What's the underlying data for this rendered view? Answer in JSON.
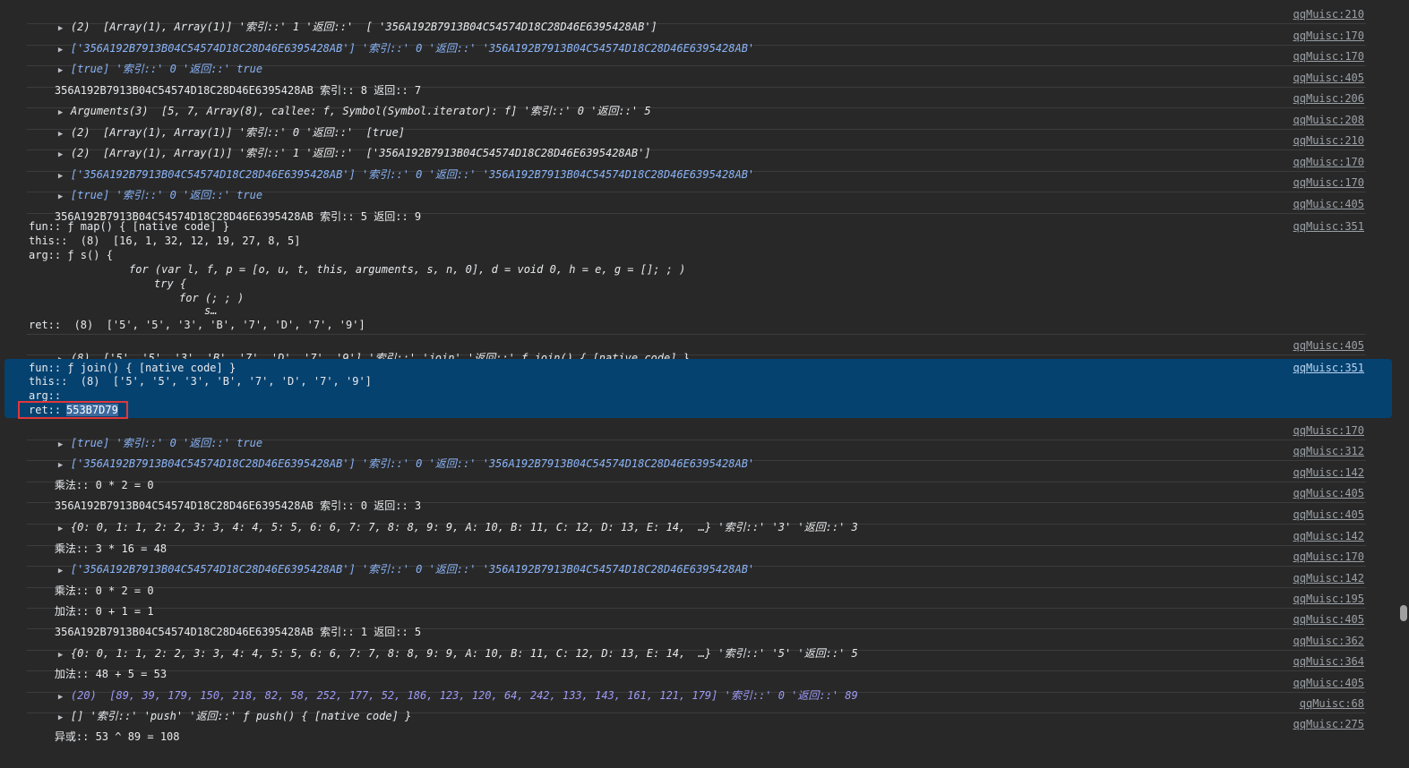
{
  "rows": [
    {
      "src": "qqMuisc:210",
      "text": "(2)  [Array(1), Array(1)] '索引::' 1 '返回::'  [ '356A192B7913B04C54574D18C28D46E6395428AB']"
    },
    {
      "src": "qqMuisc:170",
      "text": "['356A192B7913B04C54574D18C28D46E6395428AB'] '索引::' 0 '返回::' '356A192B7913B04C54574D18C28D46E6395428AB'"
    },
    {
      "src": "qqMuisc:170",
      "text": "[true] '索引::' 0 '返回::' true"
    },
    {
      "src": "qqMuisc:405",
      "text": "356A192B7913B04C54574D18C28D46E6395428AB 索引:: 8 返回:: 7"
    },
    {
      "src": "qqMuisc:206",
      "text": "Arguments(3)  [5, 7, Array(8), callee: f, Symbol(Symbol.iterator): f] '索引::' 0 '返回::' 5"
    },
    {
      "src": "qqMuisc:208",
      "text": "(2)  [Array(1), Array(1)] '索引::' 0 '返回::'  [true]"
    },
    {
      "src": "qqMuisc:210",
      "text": "(2)  [Array(1), Array(1)] '索引::' 1 '返回::'  ['356A192B7913B04C54574D18C28D46E6395428AB']"
    },
    {
      "src": "qqMuisc:170",
      "text": "['356A192B7913B04C54574D18C28D46E6395428AB'] '索引::' 0 '返回::' '356A192B7913B04C54574D18C28D46E6395428AB'"
    },
    {
      "src": "qqMuisc:170",
      "text": "[true] '索引::' 0 '返回::' true"
    },
    {
      "src": "qqMuisc:405",
      "text": "356A192B7913B04C54574D18C28D46E6395428AB 索引:: 5 返回:: 9"
    }
  ],
  "map_group": {
    "src": "qqMuisc:351",
    "fun": "fun:: ƒ map() { [native code] }",
    "this": "this::  (8)  [16, 1, 32, 12, 19, 27, 8, 5]",
    "arg": "arg:: ƒ s() {",
    "arg_body_1": "for (var l, f, p = [o, u, t, this, arguments, s, n, 0], d = void 0, h = e, g = []; ; )",
    "arg_body_2": "try {",
    "arg_body_3": "for (; ; )",
    "arg_body_4": "s…",
    "ret": "ret::  (8)  ['5', '5', '3', 'B', '7', 'D', '7', '9']"
  },
  "join_row": {
    "src": "qqMuisc:405",
    "text": "(8)  ['5', '5', '3', 'B', '7', 'D', '7', '9'] '索引::' 'join' '返回::' ƒ join() { [native code] }"
  },
  "join_group": {
    "src": "qqMuisc:351",
    "fun": "fun:: ƒ join() { [native code] }",
    "this": "this::  (8)  ['5', '5', '3', 'B', '7', 'D', '7', '9']",
    "arg": "arg::",
    "ret_label": "ret::",
    "ret_value": "553B7D79"
  },
  "rows2": [
    {
      "src": "qqMuisc:170",
      "text": "[true] '索引::' 0 '返回::' true"
    },
    {
      "src": "qqMuisc:312",
      "text": "['356A192B7913B04C54574D18C28D46E6395428AB'] '索引::' 0 '返回::' '356A192B7913B04C54574D18C28D46E6395428AB'"
    },
    {
      "src": "qqMuisc:142",
      "text": "乘法:: 0 * 2 = 0"
    },
    {
      "src": "qqMuisc:405",
      "text": "356A192B7913B04C54574D18C28D46E6395428AB 索引:: 0 返回:: 3"
    },
    {
      "src": "qqMuisc:405",
      "text": "{0: 0, 1: 1, 2: 2, 3: 3, 4: 4, 5: 5, 6: 6, 7: 7, 8: 8, 9: 9, A: 10, B: 11, C: 12, D: 13, E: 14,  …} '索引::' '3' '返回::' 3"
    },
    {
      "src": "qqMuisc:142",
      "text": "乘法:: 3 * 16 = 48"
    },
    {
      "src": "qqMuisc:170",
      "text": "['356A192B7913B04C54574D18C28D46E6395428AB'] '索引::' 0 '返回::' '356A192B7913B04C54574D18C28D46E6395428AB'"
    },
    {
      "src": "qqMuisc:142",
      "text": "乘法:: 0 * 2 = 0"
    },
    {
      "src": "qqMuisc:195",
      "text": "加法:: 0 + 1 = 1"
    },
    {
      "src": "qqMuisc:405",
      "text": "356A192B7913B04C54574D18C28D46E6395428AB 索引:: 1 返回:: 5"
    },
    {
      "src": "qqMuisc:362",
      "text": "{0: 0, 1: 1, 2: 2, 3: 3, 4: 4, 5: 5, 6: 6, 7: 7, 8: 8, 9: 9, A: 10, B: 11, C: 12, D: 13, E: 14,  …} '索引::' '5' '返回::' 5"
    },
    {
      "src": "qqMuisc:364",
      "text": "加法:: 48 + 5 = 53"
    },
    {
      "src": "qqMuisc:405",
      "text": "(20)  [89, 39, 179, 150, 218, 82, 58, 252, 177, 52, 186, 123, 120, 64, 242, 133, 143, 161, 121, 179] '索引::' 0 '返回::' 89"
    },
    {
      "src": "qqMuisc:68",
      "text": "[] '索引::' 'push' '返回::' ƒ push() { [native code] }"
    },
    {
      "src": "qqMuisc:275",
      "text": "异或:: 53 ^ 89 = 108"
    }
  ]
}
